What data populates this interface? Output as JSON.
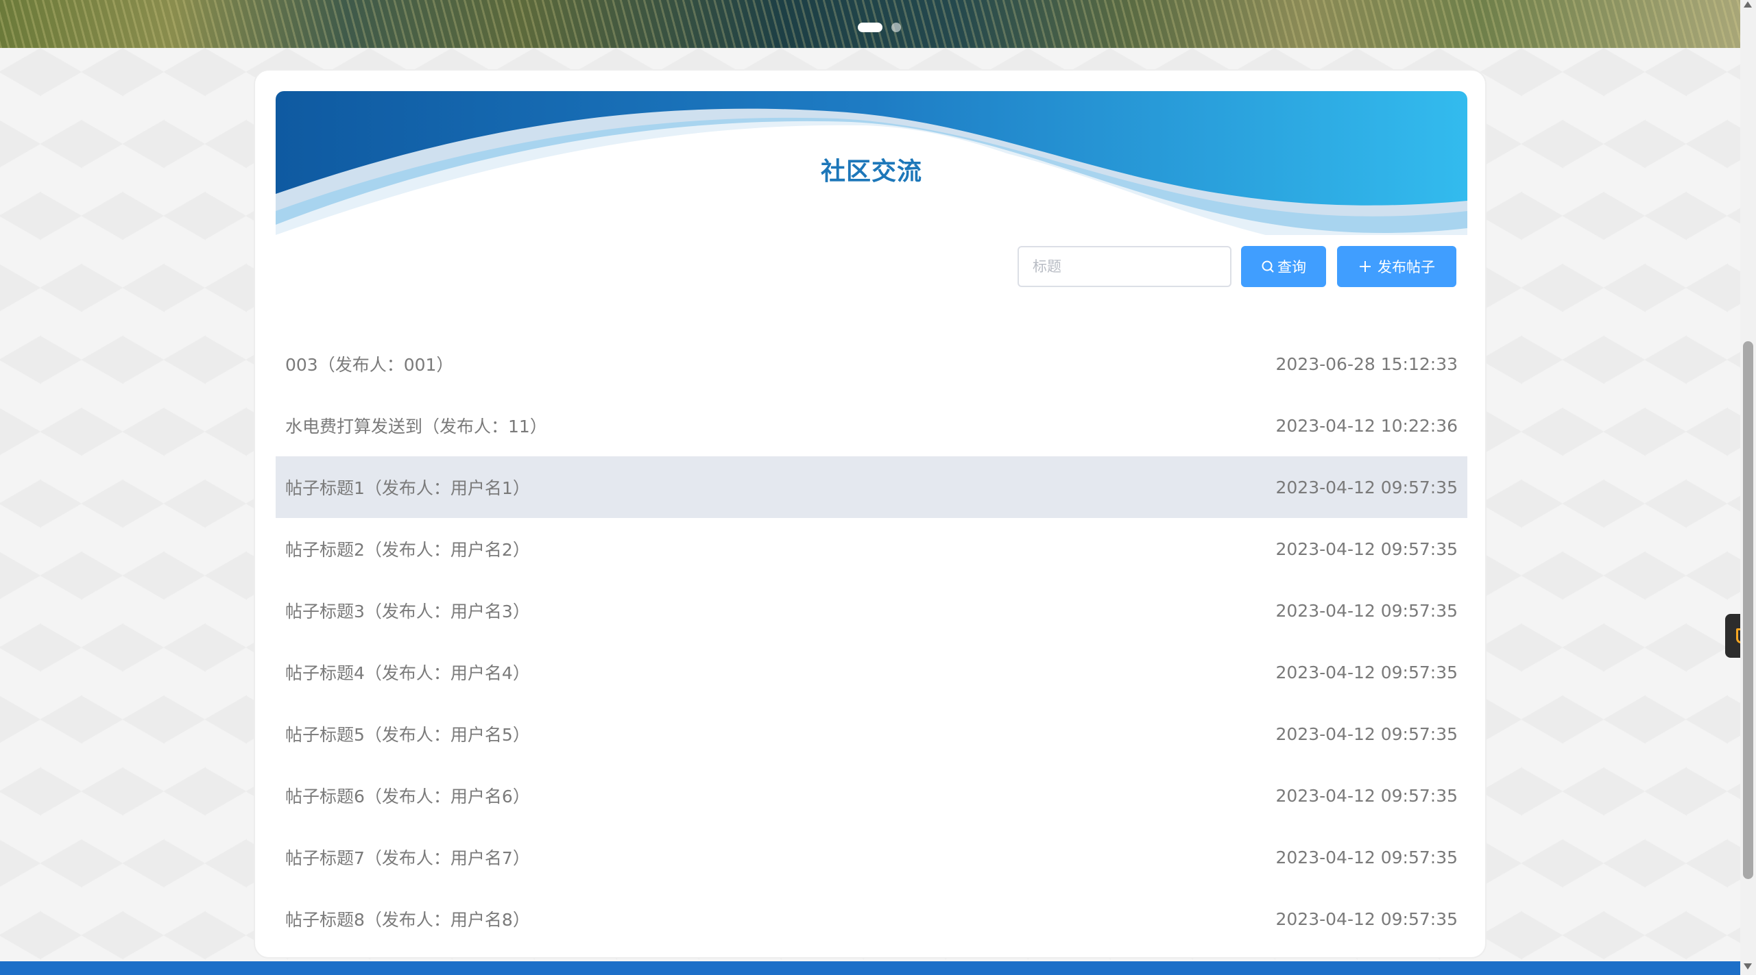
{
  "header": {
    "title": "社区交流"
  },
  "search": {
    "placeholder": "标题",
    "value": ""
  },
  "toolbar": {
    "search_label": "查询",
    "post_label": "发布帖子"
  },
  "posts": [
    {
      "title": "003（发布人：001）",
      "time": "2023-06-28 15:12:33"
    },
    {
      "title": "水电费打算发送到（发布人：11）",
      "time": "2023-04-12 10:22:36"
    },
    {
      "title": "帖子标题1（发布人：用户名1）",
      "time": "2023-04-12 09:57:35"
    },
    {
      "title": "帖子标题2（发布人：用户名2）",
      "time": "2023-04-12 09:57:35"
    },
    {
      "title": "帖子标题3（发布人：用户名3）",
      "time": "2023-04-12 09:57:35"
    },
    {
      "title": "帖子标题4（发布人：用户名4）",
      "time": "2023-04-12 09:57:35"
    },
    {
      "title": "帖子标题5（发布人：用户名5）",
      "time": "2023-04-12 09:57:35"
    },
    {
      "title": "帖子标题6（发布人：用户名6）",
      "time": "2023-04-12 09:57:35"
    },
    {
      "title": "帖子标题7（发布人：用户名7）",
      "time": "2023-04-12 09:57:35"
    },
    {
      "title": "帖子标题8（发布人：用户名8）",
      "time": "2023-04-12 09:57:35"
    }
  ],
  "icons": {
    "search": "search-icon",
    "plus": "plus-icon",
    "side_widget": "cup-icon"
  },
  "colors": {
    "primary": "#409eff",
    "title": "#1d77b9",
    "footer": "#1d6fc8",
    "row_highlight": "#e4e8ef"
  }
}
